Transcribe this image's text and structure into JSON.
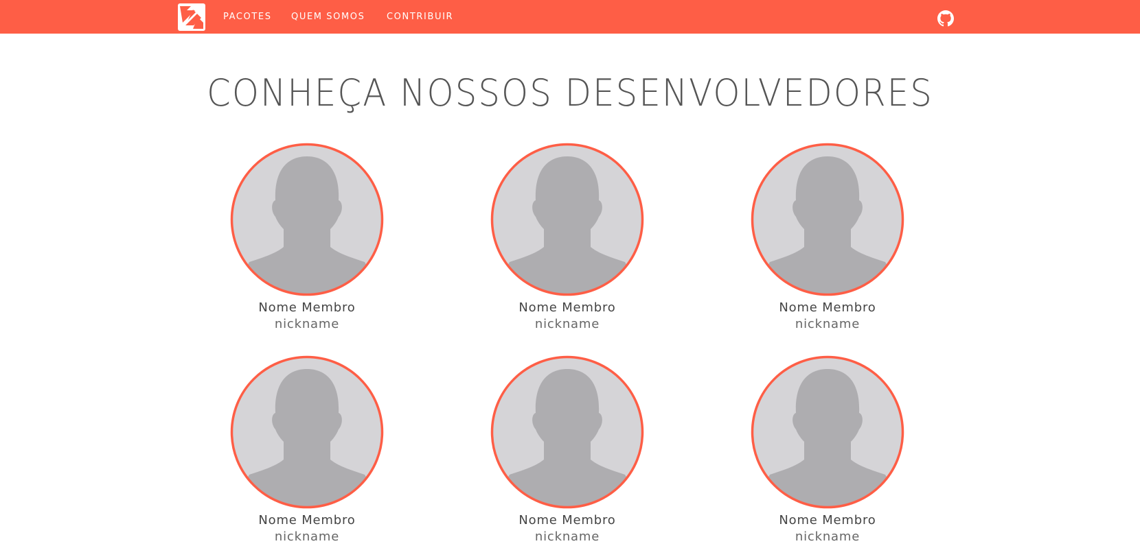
{
  "navbar": {
    "background_color": "#fe5e46",
    "logo_icon": "logo-icon",
    "links": [
      {
        "label": "PACOTES"
      },
      {
        "label": "QUEM SOMOS"
      },
      {
        "label": "CONTRIBUIR"
      }
    ],
    "github_icon": "github-icon"
  },
  "main": {
    "title": "CONHEÇA NOSSOS DESENVOLVEDORES",
    "accent_color": "#fe5e46",
    "members": [
      {
        "name": "Nome Membro",
        "nickname": "nickname",
        "avatar_icon": "avatar-placeholder-icon"
      },
      {
        "name": "Nome Membro",
        "nickname": "nickname",
        "avatar_icon": "avatar-placeholder-icon"
      },
      {
        "name": "Nome Membro",
        "nickname": "nickname",
        "avatar_icon": "avatar-placeholder-icon"
      },
      {
        "name": "Nome Membro",
        "nickname": "nickname",
        "avatar_icon": "avatar-placeholder-icon"
      },
      {
        "name": "Nome Membro",
        "nickname": "nickname",
        "avatar_icon": "avatar-placeholder-icon"
      },
      {
        "name": "Nome Membro",
        "nickname": "nickname",
        "avatar_icon": "avatar-placeholder-icon"
      }
    ]
  }
}
